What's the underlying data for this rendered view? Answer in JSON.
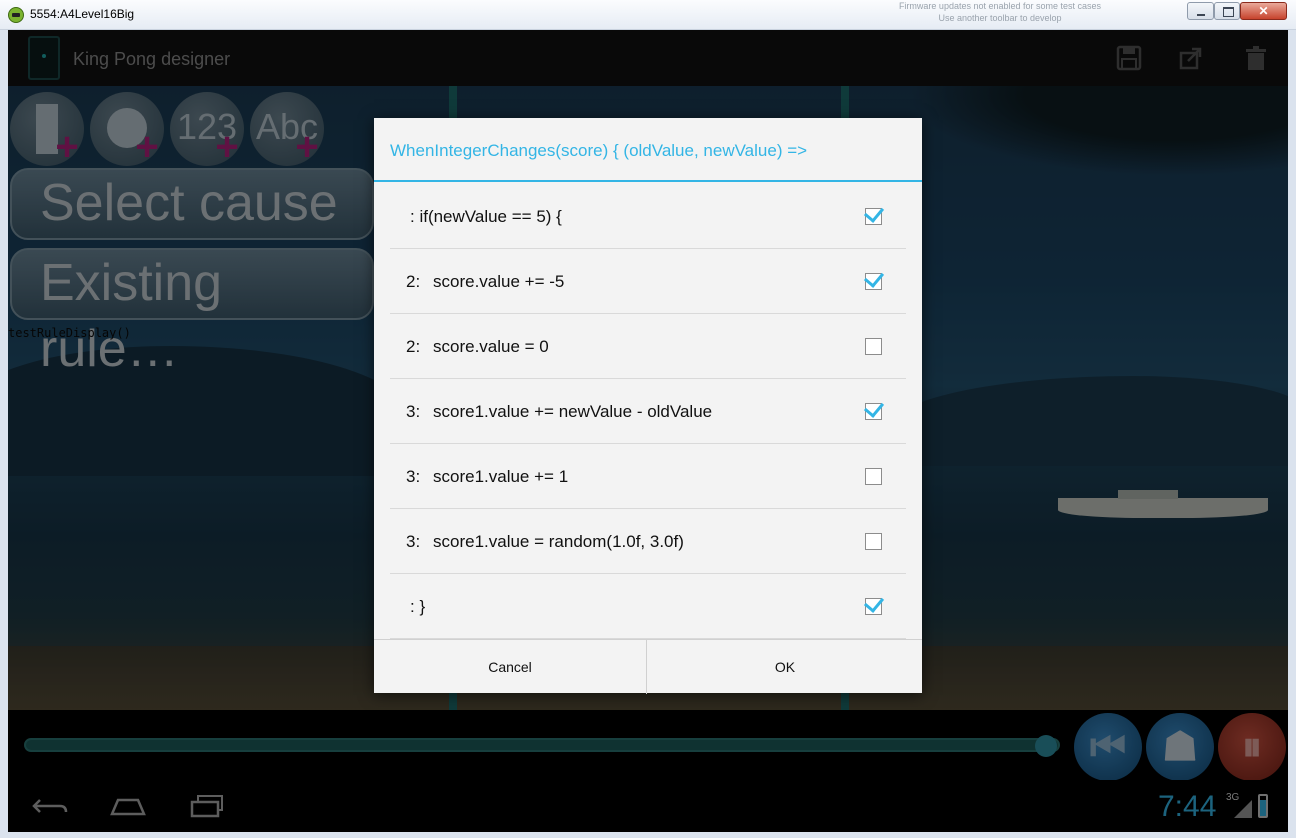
{
  "window": {
    "title": "5554:A4Level16Big",
    "background_text": "Firmware updates not enabled for some test cases\nUse another toolbar to develop"
  },
  "actionbar": {
    "title": "King Pong designer",
    "icons": [
      "save-icon",
      "share-icon",
      "delete-icon"
    ]
  },
  "toolbar": {
    "buttons": [
      {
        "name": "add-rectangle",
        "label": ""
      },
      {
        "name": "add-circle",
        "label": ""
      },
      {
        "name": "add-number",
        "label": "123"
      },
      {
        "name": "add-text",
        "label": "Abc"
      }
    ],
    "select_cause": "Select cause",
    "existing_rules": "Existing rule…",
    "debug_text": "testRuleDisplay()"
  },
  "dialog": {
    "title": "WhenIntegerChanges(score) { (oldValue, newValue) =>",
    "rows": [
      {
        "num": "",
        "code": ": if(newValue == 5) {",
        "checked": true
      },
      {
        "num": "2:",
        "code": "score.value += -5",
        "checked": true
      },
      {
        "num": "2:",
        "code": "score.value = 0",
        "checked": false
      },
      {
        "num": "3:",
        "code": "score1.value += newValue - oldValue",
        "checked": true
      },
      {
        "num": "3:",
        "code": "score1.value += 1",
        "checked": false
      },
      {
        "num": "3:",
        "code": "score1.value = random(1.0f, 3.0f)",
        "checked": false
      },
      {
        "num": "",
        "code": ": }",
        "checked": true
      }
    ],
    "cancel_label": "Cancel",
    "ok_label": "OK"
  },
  "controls": {
    "progress": 0.98
  },
  "status": {
    "clock": "7:44",
    "network": "3G"
  },
  "colors": {
    "accent": "#33b5e5",
    "actionbar": "#121212"
  }
}
